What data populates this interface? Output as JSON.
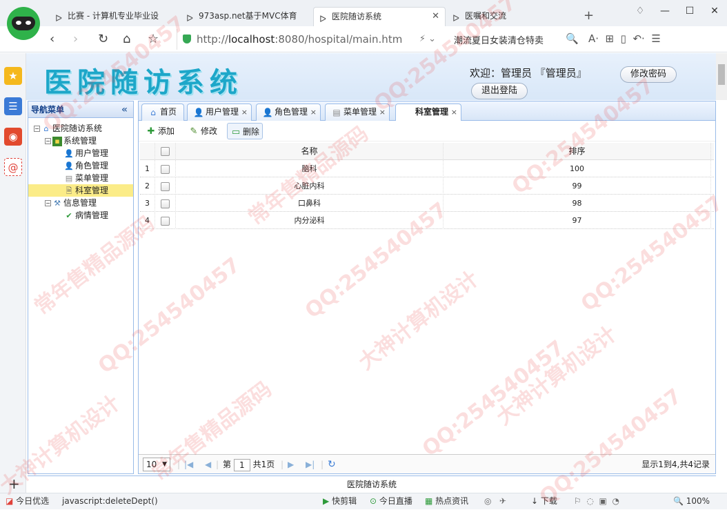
{
  "browser": {
    "tabs": [
      {
        "title": "比赛 - 计算机专业毕业设"
      },
      {
        "title": "973asp.net基于MVC体育"
      },
      {
        "title": "医院随访系统"
      },
      {
        "title": "医嘱和交流"
      }
    ],
    "url_prefix": "http://",
    "url_host": "localhost",
    "url_rest": ":8080/hospital/main.htm",
    "search_hint": "潮流夏日女装清仓特卖"
  },
  "app": {
    "title": "医院随访系统",
    "welcome": "欢迎：管理员 『管理员』",
    "change_password": "修改密码",
    "logout": "退出登陆",
    "footer": "医院随访系统"
  },
  "nav": {
    "title": "导航菜单",
    "collapse_glyph": "«",
    "tree": [
      {
        "label": "医院随访系统",
        "icon": "home-icon"
      },
      {
        "label": "系统管理",
        "icon": "book-icon"
      },
      {
        "label": "用户管理",
        "icon": "user-icon"
      },
      {
        "label": "角色管理",
        "icon": "role-icon"
      },
      {
        "label": "菜单管理",
        "icon": "menu-icon"
      },
      {
        "label": "科室管理",
        "icon": "document-icon"
      },
      {
        "label": "信息管理",
        "icon": "tools-icon"
      },
      {
        "label": "病情管理",
        "icon": "check-icon"
      }
    ]
  },
  "tabs": [
    {
      "label": "首页"
    },
    {
      "label": "用户管理"
    },
    {
      "label": "角色管理"
    },
    {
      "label": "菜单管理"
    },
    {
      "label": "科室管理"
    }
  ],
  "toolbar": {
    "add": "添加",
    "edit": "修改",
    "delete": "删除"
  },
  "grid": {
    "columns": [
      "名称",
      "排序"
    ],
    "rows": [
      {
        "num": "1",
        "name": "脑科",
        "order": "100"
      },
      {
        "num": "2",
        "name": "心脏内科",
        "order": "99"
      },
      {
        "num": "3",
        "name": "口鼻科",
        "order": "98"
      },
      {
        "num": "4",
        "name": "内分泌科",
        "order": "97"
      }
    ]
  },
  "pager": {
    "page_size": "10",
    "page_label": "第",
    "page": "1",
    "total_pages": "共1页",
    "summary": "显示1到4,共4记录"
  },
  "status": {
    "left": "今日优选",
    "js": "javascript:deleteDept()",
    "items": [
      "快剪辑",
      "今日直播",
      "热点资讯"
    ],
    "download": "下载",
    "zoom": "100%"
  },
  "watermark": {
    "lines": [
      "QQ:254540457",
      "常年售精品源码",
      "大神计算机设计"
    ]
  },
  "colors": {
    "accent": "#99bbe8",
    "title": "#1da7c9",
    "selected": "#fbec88",
    "watermark": "#e63c3c"
  }
}
